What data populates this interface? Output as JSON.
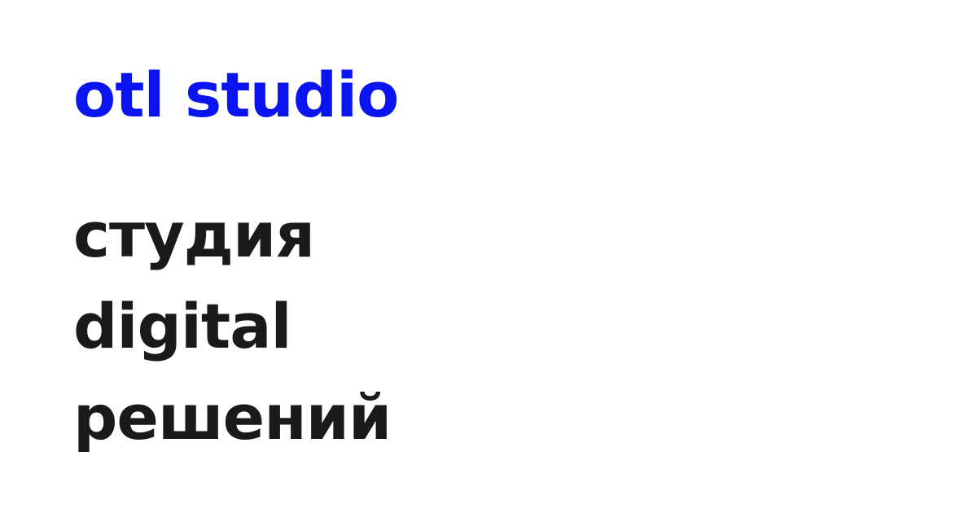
{
  "brand": {
    "name": "otl studio",
    "color": "#0a14f0"
  },
  "tagline": {
    "lines": [
      "студия",
      "digital",
      "решений"
    ],
    "color": "#1a1a1a"
  }
}
